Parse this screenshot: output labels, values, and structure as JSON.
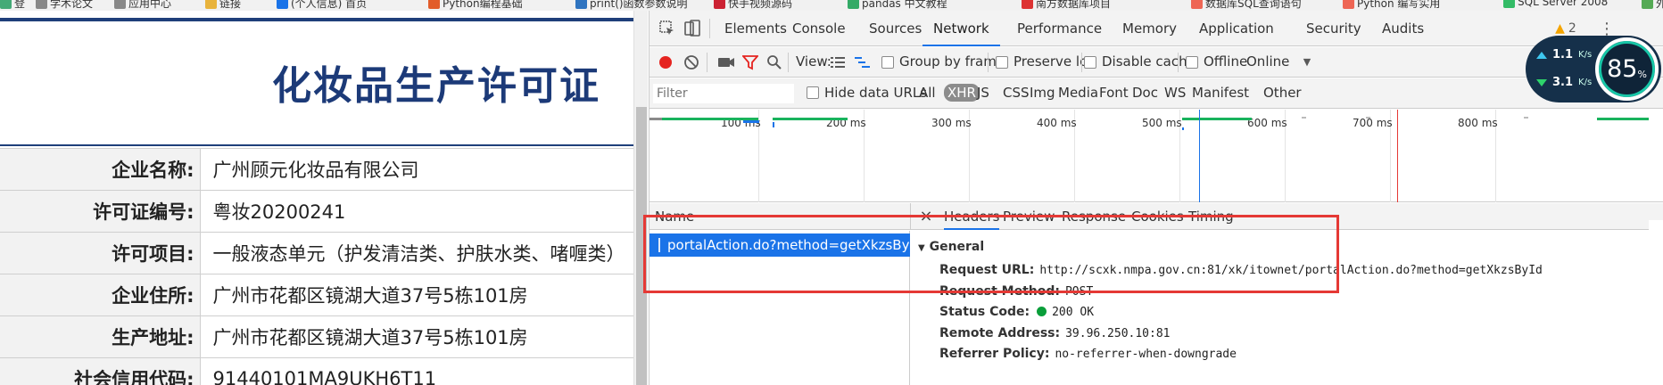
{
  "bookmarks": [
    {
      "label": "登",
      "color": "#4a7"
    },
    {
      "label": "学术论文",
      "color": "#888"
    },
    {
      "label": "应用中心",
      "color": "#888"
    },
    {
      "label": "链接",
      "color": "#e8b33c"
    },
    {
      "label": "(个人信息) 首页",
      "color": "#1a73e8"
    },
    {
      "label": "Python编程基础",
      "color": "#e25c2a"
    },
    {
      "label": "print()函数参数说明",
      "color": "#2f74c0"
    },
    {
      "label": "快手视频源码",
      "color": "#c23"
    },
    {
      "label": "pandas 中文教程",
      "color": "#3a6"
    },
    {
      "label": "南方数据库项目",
      "color": "#d33"
    },
    {
      "label": "数据库SQL查询语句",
      "color": "#e65"
    },
    {
      "label": "Python 编写实用",
      "color": "#e65"
    },
    {
      "label": "SQL Server 2008",
      "color": "#3b6"
    },
    {
      "label": "外",
      "color": "#5a5"
    }
  ],
  "page": {
    "title": "化妆品生产许可证",
    "rows": [
      {
        "label": "企业名称:",
        "value": "广州顾元化妆品有限公司"
      },
      {
        "label": "许可证编号:",
        "value": "粤妆20200241"
      },
      {
        "label": "许可项目:",
        "value": "一般液态单元（护发清洁类、护肤水类、啫喱类）"
      },
      {
        "label": "企业住所:",
        "value": "广州市花都区镜湖大道37号5栋101房"
      },
      {
        "label": "生产地址:",
        "value": "广州市花都区镜湖大道37号5栋101房"
      },
      {
        "label": "社会信用代码:",
        "value": "91440101MA9UKH6T11"
      }
    ]
  },
  "devtools": {
    "tabs": [
      "Elements",
      "Console",
      "Sources",
      "Network",
      "Performance",
      "Memory",
      "Application",
      "Security",
      "Audits"
    ],
    "active_tab": "Network",
    "warning_count": "2",
    "toolbar": {
      "view_label": "View:",
      "group_by_frame": "Group by frame",
      "preserve_log": "Preserve log",
      "disable_cache": "Disable cache",
      "offline": "Offline",
      "throttle": "Online"
    },
    "filter": {
      "placeholder": "Filter",
      "hide_data_urls": "Hide data URLs",
      "types": [
        "All",
        "XHR",
        "JS",
        "CSS",
        "Img",
        "Media",
        "Font",
        "Doc",
        "WS",
        "Manifest",
        "Other"
      ],
      "active_type": "XHR"
    },
    "timeline_labels": [
      "100 ms",
      "200 ms",
      "300 ms",
      "400 ms",
      "500 ms",
      "600 ms",
      "700 ms",
      "800 ms"
    ],
    "name_header": "Name",
    "detail_tabs": [
      "Headers",
      "Preview",
      "Response",
      "Cookies",
      "Timing"
    ],
    "active_detail_tab": "Headers",
    "request_name": "portalAction.do?method=getXkzsById",
    "general_title": "General",
    "general": [
      {
        "key": "Request URL:",
        "value": "http://scxk.nmpa.gov.cn:81/xk/itownet/portalAction.do?method=getXkzsById"
      },
      {
        "key": "Request Method:",
        "value": "POST"
      },
      {
        "key": "Status Code:",
        "value": "200 OK"
      },
      {
        "key": "Remote Address:",
        "value": "39.96.250.10:81"
      },
      {
        "key": "Referrer Policy:",
        "value": "no-referrer-when-downgrade"
      }
    ]
  },
  "widget": {
    "upload": "1.1",
    "download": "3.1",
    "unit": "K/s",
    "percent": "85",
    "percent_sign": "%"
  }
}
